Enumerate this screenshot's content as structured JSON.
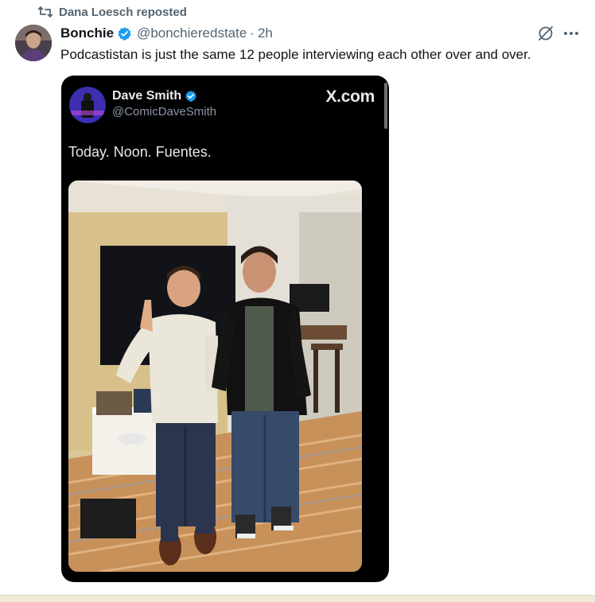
{
  "repost": {
    "text": "Dana Loesch reposted"
  },
  "tweet": {
    "display_name": "Bonchie",
    "handle": "@bonchieredstate",
    "separator": "·",
    "time": "2h",
    "text": "Podcastistan is just the same 12 people interviewing each other over and over."
  },
  "embed": {
    "display_name": "Dave Smith",
    "handle": "@ComicDaveSmith",
    "watermark": "X.com",
    "text": "Today. Noon. Fuentes."
  },
  "colors": {
    "accent": "#1d9bf0",
    "secondary_text": "#536471",
    "media_bg": "#000000"
  },
  "icons": [
    "repost-icon",
    "verified-badge-icon",
    "grok-icon",
    "more-icon"
  ]
}
